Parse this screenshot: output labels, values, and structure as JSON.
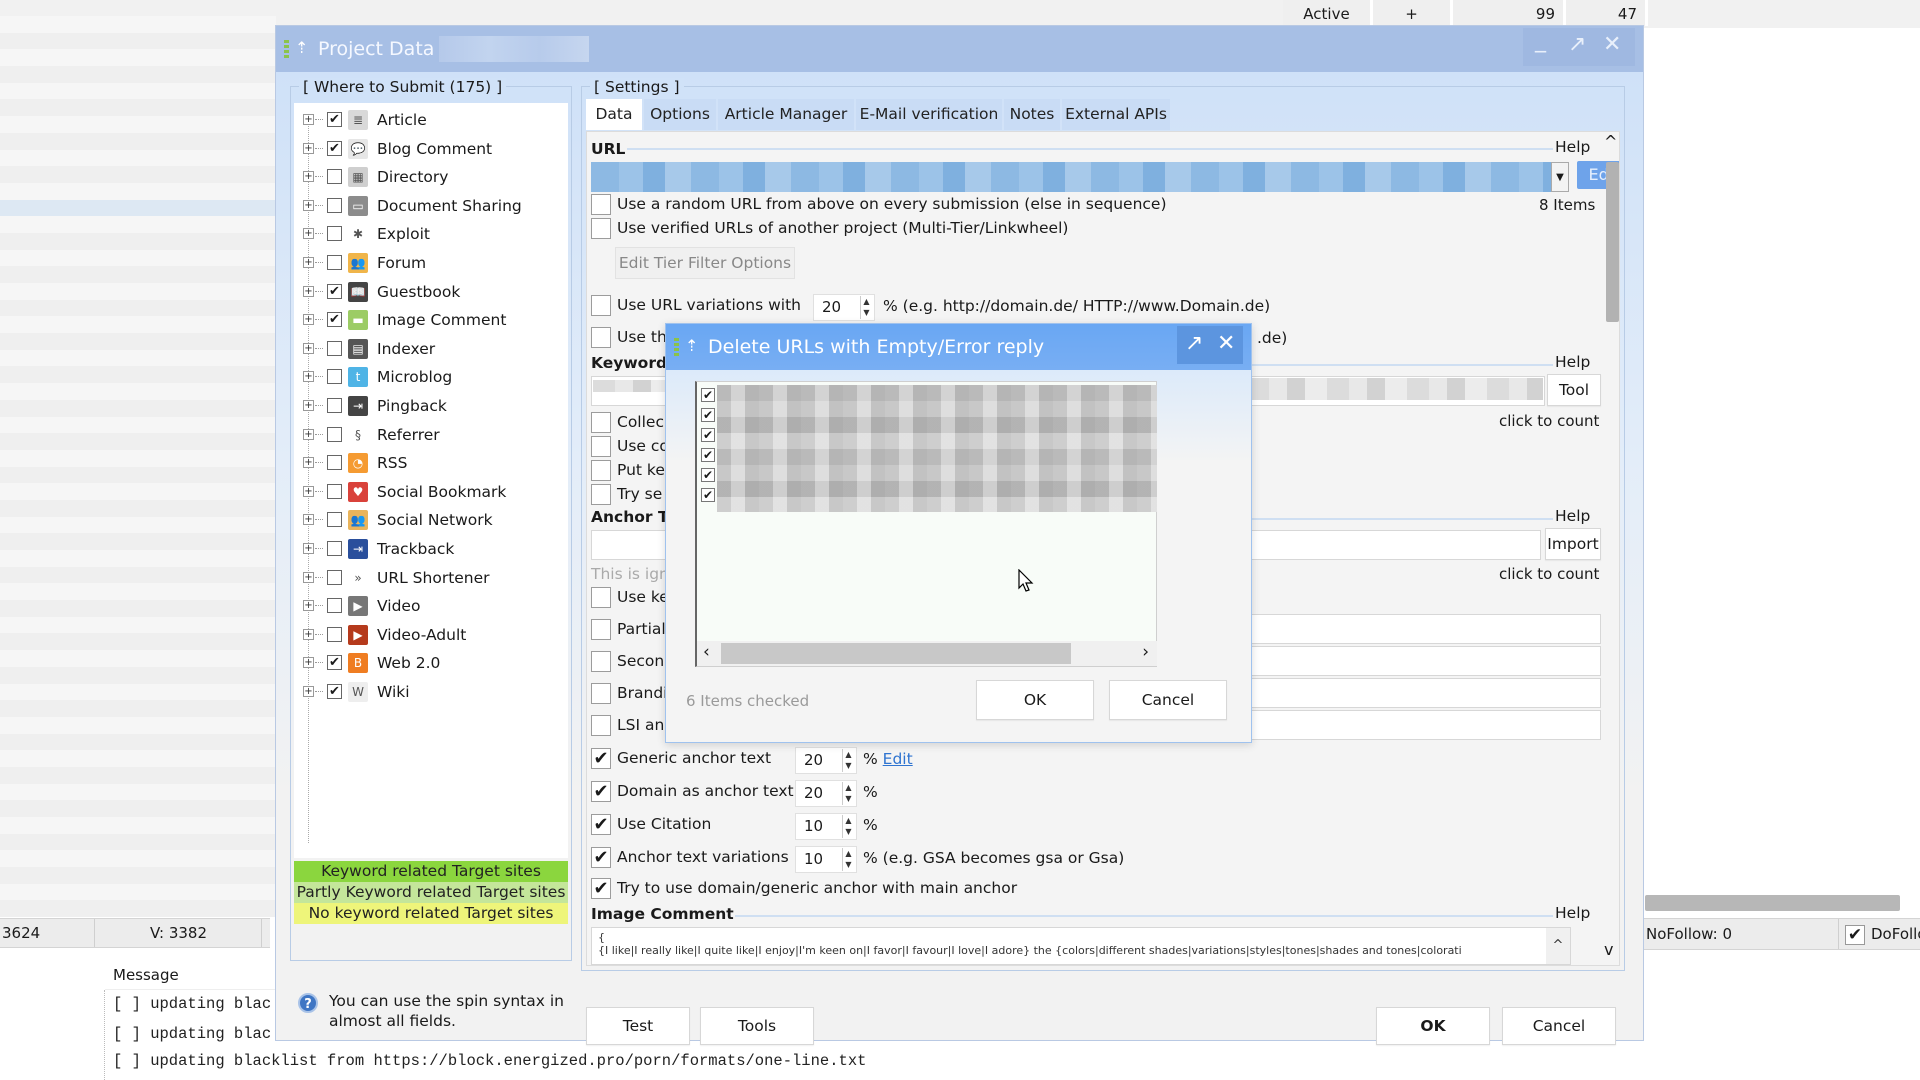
{
  "background": {
    "top_cells": [
      "Active",
      "+",
      "99",
      "47"
    ],
    "status_left": {
      "cell1": "3624",
      "cell2": "V: 3382"
    },
    "message_header": "Message",
    "log_lines": [
      "[ ] updating blac",
      "[ ] updating blac",
      "[ ] updating blacklist from https://block.energized.pro/porn/formats/one-line.txt"
    ],
    "status_right": {
      "nofollow": "NoFollow:  0",
      "dofollow_label": "DoFollo",
      "dofollow_checked": true
    }
  },
  "main_dialog": {
    "title": "Project Data ·",
    "window_buttons": {
      "minimize": "_",
      "maximize": "↗",
      "close": "✕"
    },
    "where_to_submit": {
      "legend": "[ Where to Submit  (175) ]",
      "items": [
        {
          "label": "Article",
          "checked": true,
          "icon": "article-icon",
          "color": "#d9d9d9",
          "glyph": "≣"
        },
        {
          "label": "Blog Comment",
          "checked": true,
          "icon": "blog-comment-icon",
          "color": "#e6e6e6",
          "glyph": "💬"
        },
        {
          "label": "Directory",
          "checked": false,
          "icon": "directory-icon",
          "color": "#cfcfcf",
          "glyph": "▦"
        },
        {
          "label": "Document Sharing",
          "checked": false,
          "icon": "document-sharing-icon",
          "color": "#8c8c8c",
          "glyph": "▭"
        },
        {
          "label": "Exploit",
          "checked": false,
          "icon": "exploit-icon",
          "color": "#ffffff",
          "glyph": "✱"
        },
        {
          "label": "Forum",
          "checked": false,
          "icon": "forum-icon",
          "color": "#f0b54a",
          "glyph": "👥"
        },
        {
          "label": "Guestbook",
          "checked": true,
          "icon": "guestbook-icon",
          "color": "#444444",
          "glyph": "📖"
        },
        {
          "label": "Image Comment",
          "checked": true,
          "icon": "image-comment-icon",
          "color": "#9ccc65",
          "glyph": "▬"
        },
        {
          "label": "Indexer",
          "checked": false,
          "icon": "indexer-icon",
          "color": "#555555",
          "glyph": "▤"
        },
        {
          "label": "Microblog",
          "checked": false,
          "icon": "microblog-icon",
          "color": "#4fb4e6",
          "glyph": "t"
        },
        {
          "label": "Pingback",
          "checked": false,
          "icon": "pingback-icon",
          "color": "#444444",
          "glyph": "⇥"
        },
        {
          "label": "Referrer",
          "checked": false,
          "icon": "referrer-icon",
          "color": "#ffffff",
          "glyph": "§"
        },
        {
          "label": "RSS",
          "checked": false,
          "icon": "rss-icon",
          "color": "#f59b32",
          "glyph": "◔"
        },
        {
          "label": "Social Bookmark",
          "checked": false,
          "icon": "social-bookmark-icon",
          "color": "#d9423b",
          "glyph": "♥"
        },
        {
          "label": "Social Network",
          "checked": false,
          "icon": "social-network-icon",
          "color": "#e9b45c",
          "glyph": "👥"
        },
        {
          "label": "Trackback",
          "checked": false,
          "icon": "trackback-icon",
          "color": "#2a4f9c",
          "glyph": "⇥"
        },
        {
          "label": "URL Shortener",
          "checked": false,
          "icon": "url-shortener-icon",
          "color": "#ffffff",
          "glyph": "»"
        },
        {
          "label": "Video",
          "checked": false,
          "icon": "video-icon",
          "color": "#777777",
          "glyph": "▶"
        },
        {
          "label": "Video-Adult",
          "checked": false,
          "icon": "video-adult-icon",
          "color": "#b53a1c",
          "glyph": "▶"
        },
        {
          "label": "Web 2.0",
          "checked": true,
          "icon": "web20-icon",
          "color": "#ef7d22",
          "glyph": "B"
        },
        {
          "label": "Wiki",
          "checked": true,
          "icon": "wiki-icon",
          "color": "#eeeeee",
          "glyph": "W"
        }
      ],
      "legend_bars": [
        {
          "label": "Keyword related Target sites",
          "color": "#8bd63e"
        },
        {
          "label": "Partly Keyword related Target sites",
          "color": "#c4e69a"
        },
        {
          "label": "No keyword related Target sites",
          "color": "#eef57a"
        }
      ],
      "hint": "You can use the spin syntax in almost all fields."
    },
    "settings": {
      "legend": "[ Settings ]",
      "tabs": [
        "Data",
        "Options",
        "Article Manager",
        "E-Mail verification",
        "Notes",
        "External APIs"
      ],
      "active_tab": "Data",
      "url": {
        "heading": "URL",
        "help": "Help",
        "edit_button": "Edit",
        "items_count": "8 Items",
        "random_url": {
          "label": "Use a random URL from above on every submission (else in sequence)",
          "checked": false
        },
        "verified_urls": {
          "label": "Use verified URLs of another project (Multi-Tier/Linkwheel)",
          "checked": false
        },
        "tier_filter_button": "Edit Tier Filter Options",
        "url_variations": {
          "label": "Use URL variations with",
          "value": "20",
          "suffix": "% (e.g. http://domain.de/ HTTP://www.Domain.de)",
          "checked": false
        },
        "use_th": {
          "label": "Use th",
          "suffix": ".de)",
          "checked": false
        }
      },
      "keywords": {
        "heading": "Keyword",
        "help": "Help",
        "tool_button": "Tool",
        "click_to_count": "click to count",
        "options": [
          {
            "label": "Collec",
            "checked": false
          },
          {
            "label": "Use co",
            "checked": false
          },
          {
            "label": "Put ke",
            "checked": false
          },
          {
            "label": "Try se",
            "checked": false
          }
        ]
      },
      "anchor": {
        "heading": "Anchor T",
        "help": "Help",
        "import_button": "Import",
        "click_to_count": "click to count",
        "ignored_hint": "This is ign",
        "options": [
          {
            "label": "Use ke",
            "checked": false
          },
          {
            "label": "Partial",
            "checked": false
          },
          {
            "label": "Secon",
            "checked": false
          },
          {
            "label": "Brandi",
            "checked": false
          },
          {
            "label": "LSI an",
            "checked": false
          }
        ],
        "percent_options": [
          {
            "label": "Generic anchor text",
            "checked": true,
            "value": "20",
            "suffix": "%",
            "link": "Edit"
          },
          {
            "label": "Domain as anchor text",
            "checked": true,
            "value": "20",
            "suffix": "%"
          },
          {
            "label": "Use Citation",
            "checked": true,
            "value": "10",
            "suffix": "%"
          },
          {
            "label": "Anchor text variations",
            "checked": true,
            "value": "10",
            "suffix": "% (e.g. GSA becomes gsa or Gsa)"
          }
        ],
        "try_domain_generic": {
          "label": "Try to use domain/generic anchor with main anchor",
          "checked": true
        }
      },
      "image_comment": {
        "heading": "Image Comment",
        "help": "Help",
        "line1": "{",
        "line2": "{I like|I really like|I quite like|I enjoy|I'm keen on|I favor|I favour|I love|I adore} the {colors|different shades|variations|styles|tones|shades and tones|colorati"
      }
    },
    "footer": {
      "test": "Test",
      "tools": "Tools",
      "ok": "OK",
      "cancel": "Cancel"
    }
  },
  "sub_dialog": {
    "title": "Delete URLs with Empty/Error reply",
    "window_buttons": {
      "maximize": "↗",
      "close": "✕"
    },
    "items_checked": [
      true,
      true,
      true,
      true,
      true,
      true
    ],
    "status": "6 Items checked",
    "ok": "OK",
    "cancel": "Cancel"
  }
}
